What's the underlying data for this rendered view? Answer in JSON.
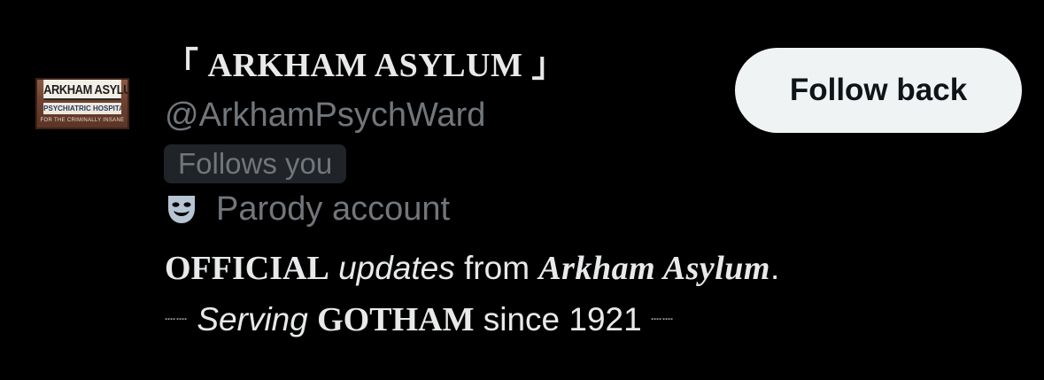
{
  "profile": {
    "avatar": {
      "sign_title": "ARKHAM ASYLUM",
      "sign_subtitle": "PSYCHIATRIC HOSPITAL",
      "sign_footer": "FOR THE CRIMINALLY INSANE"
    },
    "display_name": "「 ARKHAM ASYLUM 」",
    "handle": "@ArkhamPsychWard",
    "follows_you_label": "Follows you",
    "parody": {
      "icon": "theater-mask-icon",
      "label": "Parody account"
    },
    "bio": {
      "line1": {
        "part1": "OFFICIAL",
        "part2": "updates",
        "part3": "from",
        "part4": "Arkham Asylum",
        "part5": "."
      },
      "line2": {
        "dots_left": "┈┈",
        "part1": "Serving",
        "part2": "GOTHAM",
        "part3": "since 1921",
        "dots_right": "┈┈"
      }
    }
  },
  "actions": {
    "follow_back_label": "Follow back"
  },
  "colors": {
    "background": "#000000",
    "primary_text": "#e7e9ea",
    "secondary_text": "#71767b",
    "badge_background": "#202327",
    "button_background": "#eff3f4",
    "button_text": "#0f1419",
    "mask_icon": "#b7c4d3"
  }
}
